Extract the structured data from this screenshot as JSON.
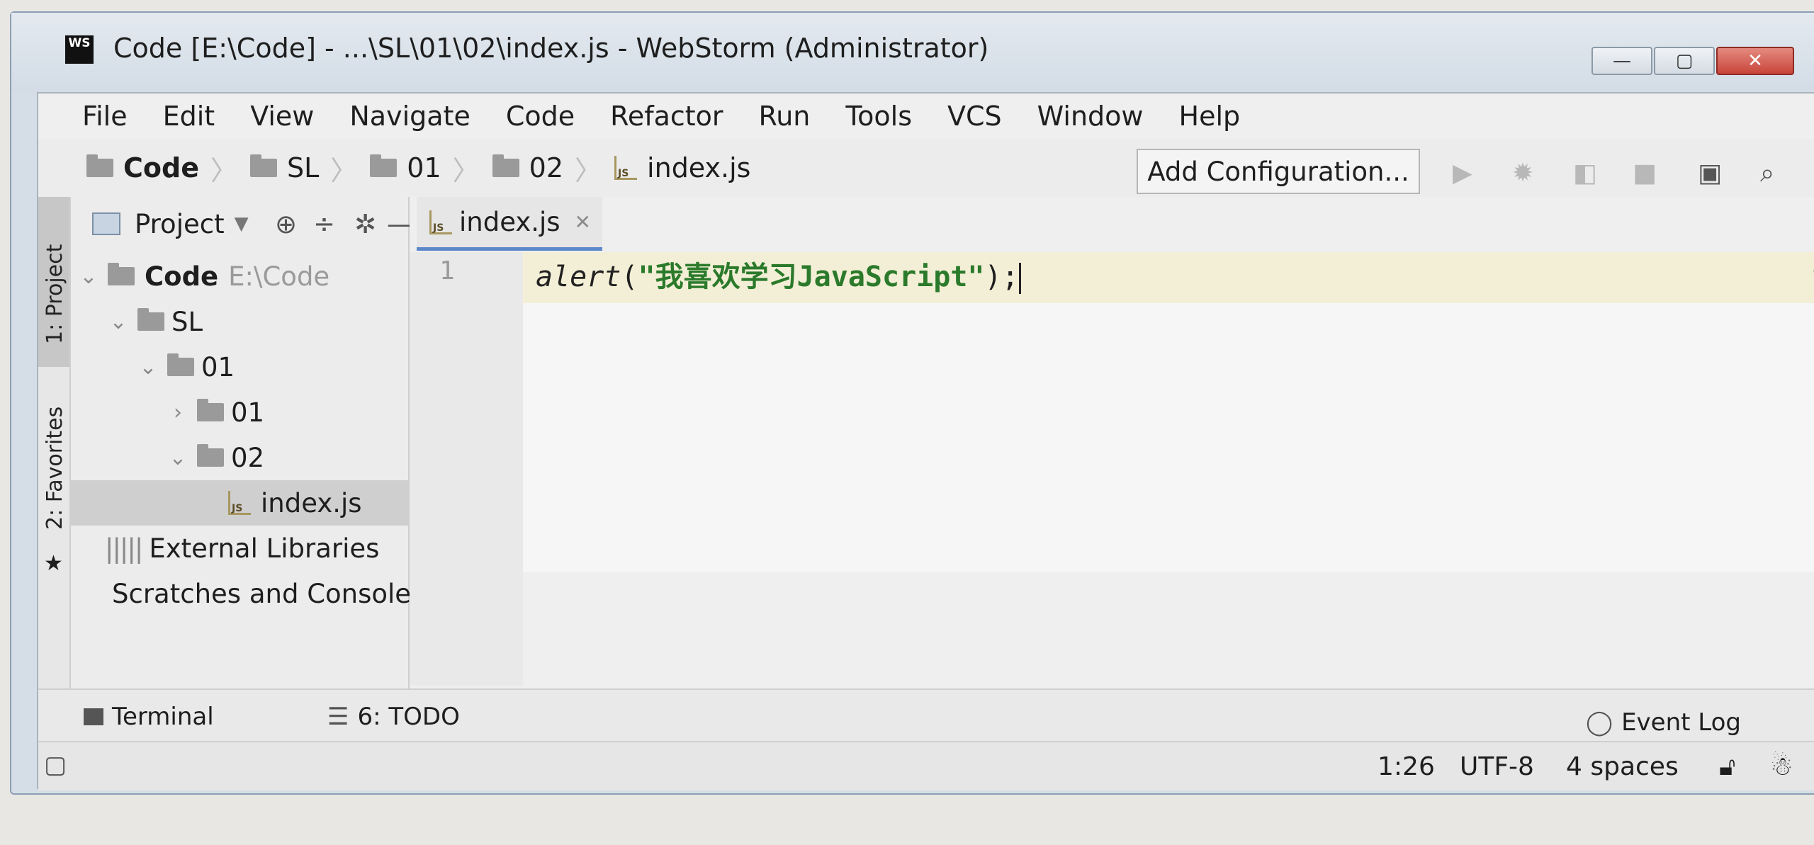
{
  "window": {
    "logo": "WS",
    "title": "Code [E:\\Code] - ...\\SL\\01\\02\\index.js - WebStorm (Administrator)",
    "buttons": {
      "minimize": "—",
      "maximize": "▢",
      "close": "✕"
    }
  },
  "menu": [
    "File",
    "Edit",
    "View",
    "Navigate",
    "Code",
    "Refactor",
    "Run",
    "Tools",
    "VCS",
    "Window",
    "Help"
  ],
  "breadcrumb": [
    "Code",
    "SL",
    "01",
    "02",
    "index.js"
  ],
  "toolbar": {
    "add_configuration": "Add Configuration..."
  },
  "side_strip": {
    "project": "1: Project",
    "favorites": "2: Favorites"
  },
  "project_panel": {
    "title": "Project",
    "tree": {
      "root": {
        "name": "Code",
        "path": "E:\\Code"
      },
      "sl": "SL",
      "f01": "01",
      "f01_01": "01",
      "f02": "02",
      "file": "index.js",
      "external": "External Libraries",
      "scratches": "Scratches and Consoles"
    }
  },
  "editor": {
    "tab": "index.js",
    "line_number": "1",
    "code": {
      "fn": "alert",
      "open": "(",
      "string": "\"我喜欢学习JavaScript\"",
      "close": ");"
    }
  },
  "bottom_tools": {
    "terminal": "Terminal",
    "todo": "6: TODO",
    "event_log": "Event Log"
  },
  "status": {
    "position": "1:26",
    "encoding": "UTF-8",
    "indent": "4 spaces"
  }
}
